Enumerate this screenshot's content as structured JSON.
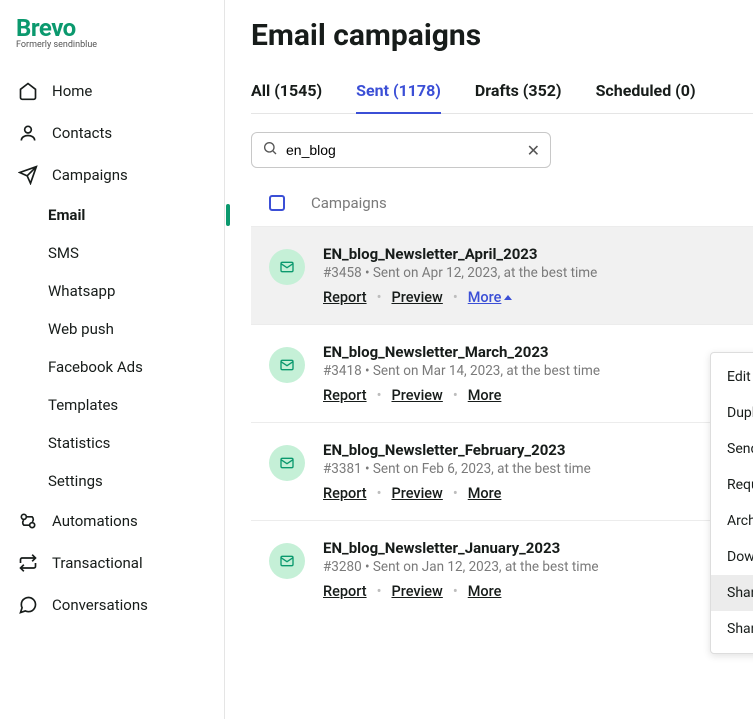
{
  "brand": {
    "name": "Brevo",
    "tagline": "Formerly sendinblue"
  },
  "sidebar": {
    "items": [
      {
        "label": "Home"
      },
      {
        "label": "Contacts"
      },
      {
        "label": "Campaigns"
      },
      {
        "label": "Automations"
      },
      {
        "label": "Transactional"
      },
      {
        "label": "Conversations"
      }
    ],
    "sub": [
      {
        "label": "Email"
      },
      {
        "label": "SMS"
      },
      {
        "label": "Whatsapp"
      },
      {
        "label": "Web push"
      },
      {
        "label": "Facebook Ads"
      },
      {
        "label": "Templates"
      },
      {
        "label": "Statistics"
      },
      {
        "label": "Settings"
      }
    ]
  },
  "page_title": "Email campaigns",
  "tabs": [
    {
      "label": "All (1545)"
    },
    {
      "label": "Sent (1178)"
    },
    {
      "label": "Drafts (352)"
    },
    {
      "label": "Scheduled (0)"
    }
  ],
  "search": {
    "value": "en_blog"
  },
  "table_header": "Campaigns",
  "actions": {
    "report": "Report",
    "preview": "Preview",
    "more": "More"
  },
  "rows": [
    {
      "title": "EN_blog_Newsletter_April_2023",
      "meta": "#3458 • Sent on Apr 12, 2023, at the best time"
    },
    {
      "title": "EN_blog_Newsletter_March_2023",
      "meta": "#3418 • Sent on Mar 14, 2023, at the best time"
    },
    {
      "title": "EN_blog_Newsletter_February_2023",
      "meta": "#3381 • Sent on Feb 6, 2023, at the best time"
    },
    {
      "title": "EN_blog_Newsletter_January_2023",
      "meta": "#3280 • Sent on Jan 12, 2023, at the best time"
    }
  ],
  "dropdown": [
    "Edit",
    "Duplicate",
    "Send a test",
    "Requeue",
    "Archive",
    "Download PDF",
    "Share on Social Media",
    "Share the template"
  ]
}
